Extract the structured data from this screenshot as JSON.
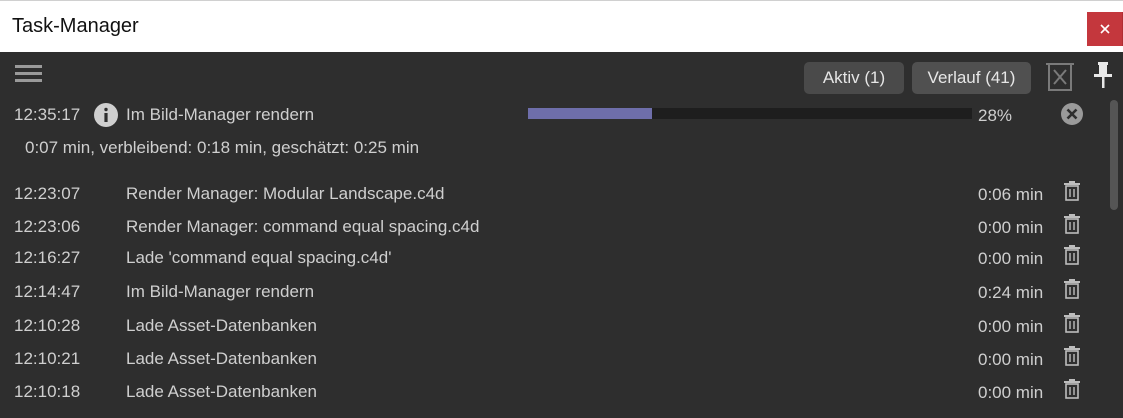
{
  "window": {
    "title": "Task-Manager",
    "close_label": "×"
  },
  "toolbar": {
    "menu_icon": "hamburger-menu-icon",
    "tab_active": "Aktiv (1)",
    "tab_history": "Verlauf (41)",
    "clear_icon": "clear-list-icon",
    "pin_icon": "pin-icon"
  },
  "active_task": {
    "time": "12:35:17",
    "icon": "info-icon",
    "name": "Im Bild-Manager rendern",
    "progress": 0.28,
    "progress_label": "28%",
    "detail": "0:07 min, verbleibend: 0:18 min, geschätzt: 0:25 min",
    "progress_color": "#6e6eaa"
  },
  "history": [
    {
      "time": "12:23:07",
      "name": "Render Manager: Modular Landscape.c4d",
      "duration": "0:06 min"
    },
    {
      "time": "12:23:06",
      "name": "Render Manager: command equal spacing.c4d",
      "duration": "0:00 min"
    },
    {
      "time": "12:16:27",
      "name": "Lade 'command equal spacing.c4d'",
      "duration": "0:00 min"
    },
    {
      "time": "12:14:47",
      "name": "Im Bild-Manager rendern",
      "duration": "0:24 min"
    },
    {
      "time": "12:10:28",
      "name": "Lade Asset-Datenbanken",
      "duration": "0:00 min"
    },
    {
      "time": "12:10:21",
      "name": "Lade Asset-Datenbanken",
      "duration": "0:00 min"
    },
    {
      "time": "12:10:18",
      "name": "Lade Asset-Datenbanken",
      "duration": "0:00 min"
    }
  ]
}
